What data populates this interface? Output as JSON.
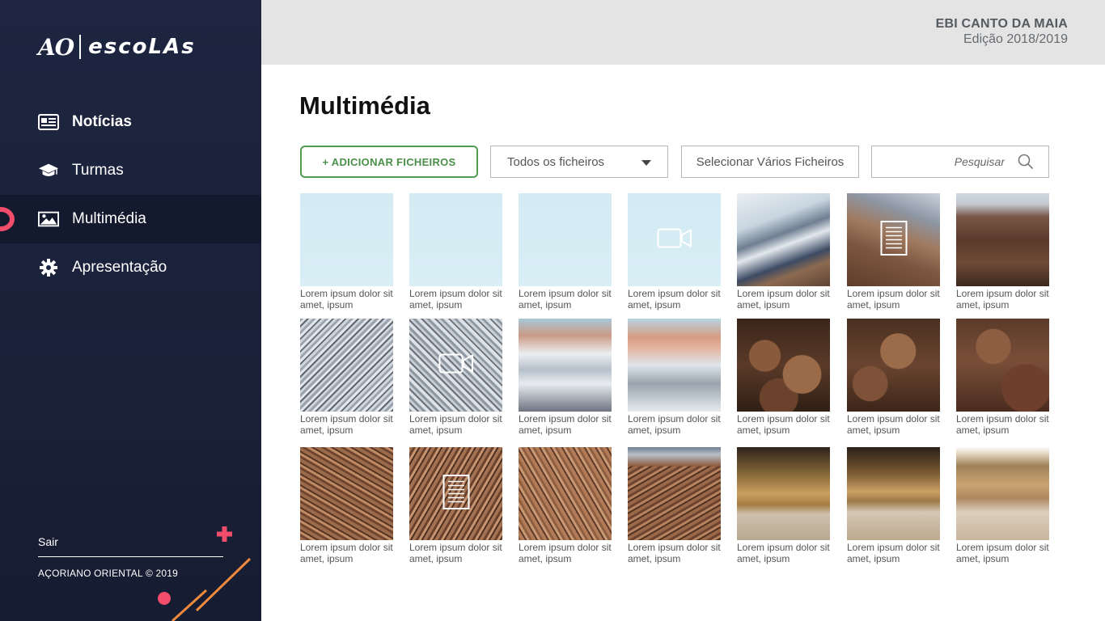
{
  "brand": {
    "logo_ao": "AO",
    "logo_escolas": "escoLAs"
  },
  "sidebar": {
    "items": [
      {
        "label": "Notícias",
        "icon": "newspaper-icon",
        "active": false,
        "bold": true
      },
      {
        "label": "Turmas",
        "icon": "graduation-cap-icon",
        "active": false,
        "bold": false
      },
      {
        "label": "Multimédia",
        "icon": "image-icon",
        "active": true,
        "bold": false
      },
      {
        "label": "Apresentação",
        "icon": "gear-icon",
        "active": false,
        "bold": false
      }
    ],
    "logout_label": "Sair",
    "copyright": "AÇORIANO ORIENTAL © 2019"
  },
  "header": {
    "school_name": "EBI CANTO DA MAIA",
    "edition": "Edição 2018/2019"
  },
  "main": {
    "title": "Multimédia",
    "add_button": "+ ADICIONAR FICHEIROS",
    "filter_select": "Todos os ficheiros",
    "multi_select_button": "Selecionar Vários Ficheiros",
    "search_placeholder": "Pesquisar"
  },
  "colors": {
    "sidebar_bg": "#1d2540",
    "accent_pink": "#f24d6b",
    "accent_orange": "#f08a3c",
    "add_button_green": "#4f9a4f",
    "header_bg": "#e4e4e4"
  },
  "files": [
    {
      "caption": "Lorem ipsum dolor sit amet, ipsum",
      "type": "image",
      "texture": "t-sky"
    },
    {
      "caption": "Lorem ipsum dolor sit amet, ipsum",
      "type": "image",
      "texture": "t-sky"
    },
    {
      "caption": "Lorem ipsum dolor sit amet, ipsum",
      "type": "image",
      "texture": "t-sky"
    },
    {
      "caption": "Lorem ipsum dolor sit amet, ipsum",
      "type": "video",
      "texture": "t-sky"
    },
    {
      "caption": "Lorem ipsum dolor sit amet, ipsum",
      "type": "image",
      "texture": "t-snow1"
    },
    {
      "caption": "Lorem ipsum dolor sit amet, ipsum",
      "type": "document",
      "texture": "t-snow2"
    },
    {
      "caption": "Lorem ipsum dolor sit amet, ipsum",
      "type": "image",
      "texture": "t-rock1"
    },
    {
      "caption": "Lorem ipsum dolor sit amet, ipsum",
      "type": "image",
      "texture": "t-granite"
    },
    {
      "caption": "Lorem ipsum dolor sit amet, ipsum",
      "type": "video",
      "texture": "t-granite2"
    },
    {
      "caption": "Lorem ipsum dolor sit amet, ipsum",
      "type": "image",
      "texture": "t-peak1"
    },
    {
      "caption": "Lorem ipsum dolor sit amet, ipsum",
      "type": "image",
      "texture": "t-peak2"
    },
    {
      "caption": "Lorem ipsum dolor sit amet, ipsum",
      "type": "image",
      "texture": "t-boulder1"
    },
    {
      "caption": "Lorem ipsum dolor sit amet, ipsum",
      "type": "image",
      "texture": "t-boulder2"
    },
    {
      "caption": "Lorem ipsum dolor sit amet, ipsum",
      "type": "image",
      "texture": "t-boulder3"
    },
    {
      "caption": "Lorem ipsum dolor sit amet, ipsum",
      "type": "image",
      "texture": "t-rubble1"
    },
    {
      "caption": "Lorem ipsum dolor sit amet, ipsum",
      "type": "document",
      "texture": "t-rubble2"
    },
    {
      "caption": "Lorem ipsum dolor sit amet, ipsum",
      "type": "image",
      "texture": "t-rubble3"
    },
    {
      "caption": "Lorem ipsum dolor sit amet, ipsum",
      "type": "image",
      "texture": "t-rubble4"
    },
    {
      "caption": "Lorem ipsum dolor sit amet, ipsum",
      "type": "image",
      "texture": "t-grass1"
    },
    {
      "caption": "Lorem ipsum dolor sit amet, ipsum",
      "type": "image",
      "texture": "t-grass2"
    },
    {
      "caption": "Lorem ipsum dolor sit amet, ipsum",
      "type": "image",
      "texture": "t-grass3"
    }
  ]
}
